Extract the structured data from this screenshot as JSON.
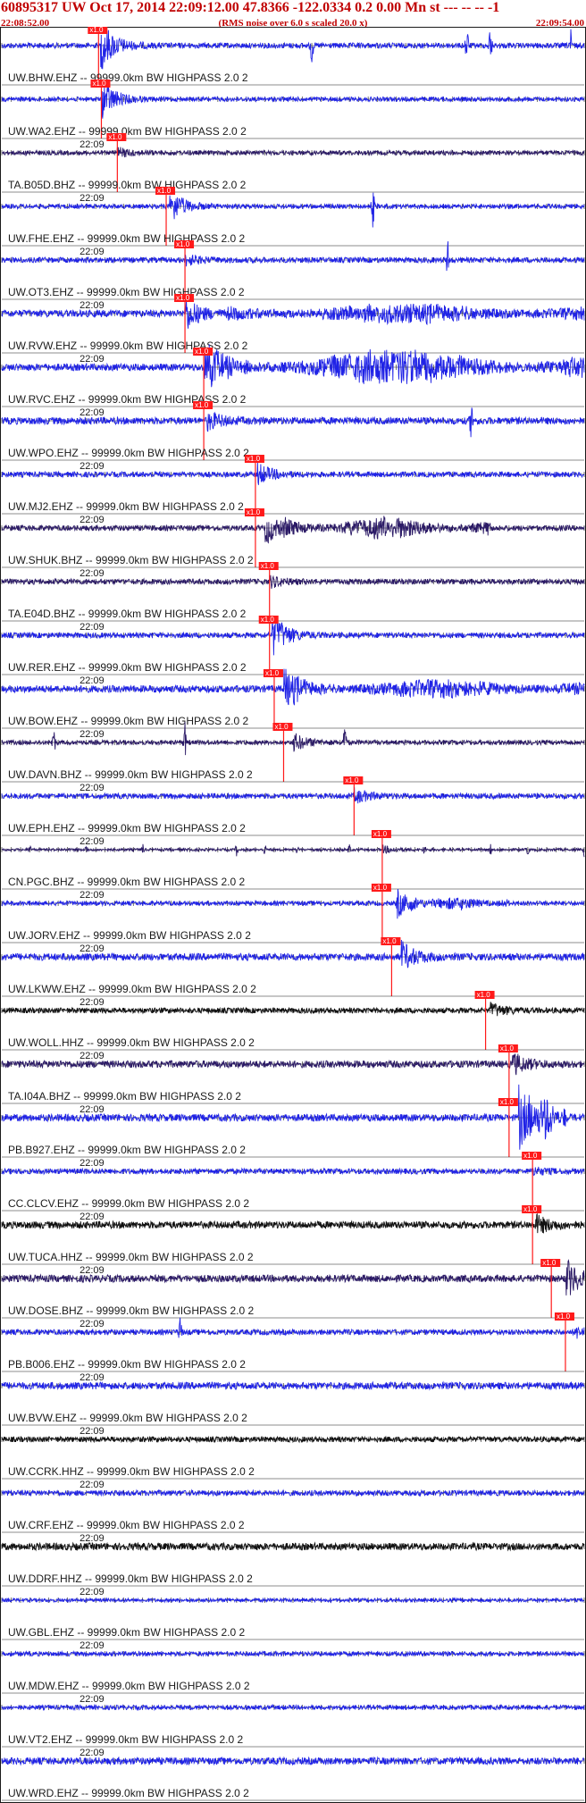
{
  "header": {
    "title": "60895317 UW Oct 17, 2014 22:09:12.00   47.8366 -122.0334  0.2 0.00 Mn st --- -- --  -1",
    "start_time": "22:08:52.00",
    "end_time": "22:09:54.00",
    "subtitle": "(RMS noise over 6.0 s scaled 20.0 x)"
  },
  "chart_data": {
    "type": "line",
    "title": "60895317 UW Oct 17, 2014 22:09:12.00   47.8366 -122.0334  0.2 0.00 Mn st --- -- --  -1",
    "x_range_s": [
      0,
      62
    ],
    "tick_interval_s": 1,
    "minute_mark_label": "22:09",
    "minute_mark_s": 8,
    "pick_label": "x1.0",
    "colors": {
      "blue": "#1f22e6",
      "purple": "#2b1a66",
      "black": "#101010",
      "pick": "#ff1a1a",
      "axis": "#1a1a1a"
    },
    "traces": [
      {
        "label": "UW.BHW.EHZ -- 99999.0km BW  HIGHPASS  2.0  2",
        "color": "blue",
        "pick": 10.3,
        "event": 10.5,
        "eamp": 28,
        "amp": 3,
        "spikes": [
          33,
          49.5,
          52,
          60.5
        ]
      },
      {
        "label": "UW.WA2.EHZ -- 99999.0km BW  HIGHPASS  2.0  2",
        "color": "blue",
        "pick": 10.6,
        "event": 10.6,
        "eamp": 22,
        "amp": 2.5
      },
      {
        "label": "TA.B05D.BHZ -- 99999.0km BW  HIGHPASS  2.0  2",
        "color": "purple",
        "pick": 12.3,
        "event": 12.3,
        "eamp": 5,
        "amp": 2.5,
        "showMinute": true
      },
      {
        "label": "UW.FHE.EHZ -- 99999.0km BW  HIGHPASS  2.0  2",
        "color": "blue",
        "pick": 17.5,
        "event": 17.8,
        "eamp": 20,
        "amp": 2.5,
        "spikes": [
          39.5
        ],
        "showMinute": true
      },
      {
        "label": "UW.OT3.EHZ -- 99999.0km BW  HIGHPASS  2.0  2",
        "color": "blue",
        "pick": 19.5,
        "event": 19.5,
        "eamp": 6,
        "amp": 3,
        "spikes": [
          47.5
        ],
        "showMinute": true
      },
      {
        "label": "UW.RVW.EHZ -- 99999.0km BW  HIGHPASS  2.0  2",
        "color": "blue",
        "pick": 19.5,
        "event": 19.5,
        "eamp": 18,
        "amp": 4,
        "coda": [
          24,
          62,
          9
        ],
        "showMinute": true
      },
      {
        "label": "UW.RVC.EHZ -- 99999.0km BW  HIGHPASS  2.0  2",
        "color": "blue",
        "pick": 21.5,
        "event": 21.5,
        "eamp": 20,
        "amp": 4,
        "coda": [
          22,
          62,
          20
        ],
        "showMinute": true
      },
      {
        "label": "UW.WPO.EHZ -- 99999.0km BW  HIGHPASS  2.0  2",
        "color": "blue",
        "pick": 21.5,
        "event": 21.8,
        "eamp": 10,
        "amp": 4,
        "spikes": [
          50
        ],
        "showMinute": true
      },
      {
        "label": "UW.MJ2.EHZ -- 99999.0km BW  HIGHPASS  2.0  2",
        "color": "blue",
        "pick": 27,
        "event": 27.2,
        "eamp": 12,
        "amp": 3,
        "showMinute": true
      },
      {
        "label": "UW.SHUK.BHZ -- 99999.0km BW  HIGHPASS  2.0  2",
        "color": "purple",
        "pick": 27,
        "event": 28,
        "eamp": 18,
        "amp": 3,
        "coda": [
          30,
          52,
          12
        ],
        "showMinute": true
      },
      {
        "label": "TA.E04D.BHZ -- 99999.0km BW  HIGHPASS  2.0  2",
        "color": "purple",
        "pick": 28.5,
        "event": 28.5,
        "eamp": 6,
        "amp": 3,
        "showMinute": true
      },
      {
        "label": "UW.RER.EHZ -- 99999.0km BW  HIGHPASS  2.0  2",
        "color": "blue",
        "pick": 28.5,
        "event": 28.8,
        "eamp": 25,
        "amp": 3,
        "showMinute": true
      },
      {
        "label": "UW.BOW.EHZ -- 99999.0km BW  HIGHPASS  2.0  2",
        "color": "blue",
        "pick": 29,
        "event": 30,
        "eamp": 22,
        "amp": 4,
        "coda": [
          31,
          62,
          8
        ],
        "showMinute": true
      },
      {
        "label": "UW.DAVN.BHZ -- 99999.0km BW  HIGHPASS  2.0  2",
        "color": "purple",
        "pick": 30,
        "event": 31,
        "eamp": 10,
        "amp": 2.5,
        "spikes": [
          5.5,
          19.5,
          36.5
        ],
        "showMinute": true
      },
      {
        "label": "UW.EPH.EHZ -- 99999.0km BW  HIGHPASS  2.0  2",
        "color": "blue",
        "pick": 37.5,
        "event": 37.5,
        "eamp": 8,
        "amp": 3,
        "showMinute": true
      },
      {
        "label": "CN.PGC.BHZ -- 99999.0km BW  HIGHPASS  2.0  2",
        "color": "purple",
        "pick": 40.5,
        "event": 40.5,
        "eamp": 4,
        "amp": 1.5,
        "periodic": [
          3,
          9,
          15,
          20,
          25,
          28,
          31.5,
          37,
          45,
          52,
          56,
          62
        ],
        "showMinute": true
      },
      {
        "label": "UW.JORV.EHZ -- 99999.0km BW  HIGHPASS  2.0  2",
        "color": "blue",
        "pick": 40.5,
        "event": 42,
        "eamp": 16,
        "amp": 2.5,
        "coda": [
          43,
          54,
          6
        ],
        "showMinute": true
      },
      {
        "label": "UW.LKWW.EHZ -- 99999.0km BW  HIGHPASS  2.0  2",
        "color": "blue",
        "pick": 41.5,
        "event": 42.5,
        "eamp": 16,
        "amp": 4,
        "showMinute": true
      },
      {
        "label": "UW.WOLL.HHZ -- 99999.0km BW  HIGHPASS  2.0  2",
        "color": "black",
        "pick": 51.5,
        "event": 52,
        "eamp": 8,
        "amp": 3,
        "showMinute": true
      },
      {
        "label": "TA.I04A.BHZ -- 99999.0km BW  HIGHPASS  2.0  2",
        "color": "purple",
        "pick": 54,
        "event": 54.3,
        "eamp": 12,
        "amp": 4,
        "showMinute": true
      },
      {
        "label": "PB.B927.EHZ -- 99999.0km BW  HIGHPASS  2.0  2",
        "color": "blue",
        "pick": 54,
        "event": 55,
        "eamp": 36,
        "amp": 4,
        "coda": [
          56,
          60,
          20
        ],
        "showMinute": true
      },
      {
        "label": "CC.CLCV.EHZ -- 99999.0km BW  HIGHPASS  2.0  2",
        "color": "blue",
        "pick": 56.5,
        "event": 56.5,
        "eamp": 4,
        "amp": 3,
        "showMinute": true
      },
      {
        "label": "UW.TUCA.HHZ -- 99999.0km BW  HIGHPASS  2.0  2",
        "color": "black",
        "pick": 56.5,
        "event": 56.8,
        "eamp": 10,
        "amp": 4,
        "showMinute": true
      },
      {
        "label": "UW.DOSE.BHZ -- 99999.0km BW  HIGHPASS  2.0  2",
        "color": "purple",
        "pick": 58.5,
        "event": 60,
        "eamp": 22,
        "amp": 4,
        "showMinute": true
      },
      {
        "label": "PB.B006.EHZ -- 99999.0km BW  HIGHPASS  2.0  2",
        "color": "blue",
        "pick": 60,
        "event": 61,
        "eamp": 6,
        "amp": 3,
        "spikes": [
          19
        ],
        "showMinute": true
      },
      {
        "label": "UW.BVW.EHZ -- 99999.0km BW  HIGHPASS  2.0  2",
        "color": "blue",
        "amp": 4,
        "showMinute": true
      },
      {
        "label": "UW.CCRK.HHZ -- 99999.0km BW  HIGHPASS  2.0  2",
        "color": "black",
        "amp": 3,
        "showMinute": true
      },
      {
        "label": "UW.CRF.EHZ -- 99999.0km BW  HIGHPASS  2.0  2",
        "color": "blue",
        "amp": 3,
        "showMinute": true
      },
      {
        "label": "UW.DDRF.HHZ -- 99999.0km BW  HIGHPASS  2.0  2",
        "color": "black",
        "amp": 4,
        "showMinute": true
      },
      {
        "label": "UW.GBL.EHZ -- 99999.0km BW  HIGHPASS  2.0  2",
        "color": "blue",
        "amp": 2,
        "showMinute": true
      },
      {
        "label": "UW.MDW.EHZ -- 99999.0km BW  HIGHPASS  2.0  2",
        "color": "blue",
        "amp": 2.5,
        "showMinute": true
      },
      {
        "label": "UW.VT2.EHZ -- 99999.0km BW  HIGHPASS  2.0  2",
        "color": "blue",
        "amp": 2.5,
        "showMinute": true
      },
      {
        "label": "UW.WRD.EHZ -- 99999.0km BW  HIGHPASS  2.0  2",
        "color": "blue",
        "amp": 4,
        "showMinute": true
      }
    ]
  }
}
